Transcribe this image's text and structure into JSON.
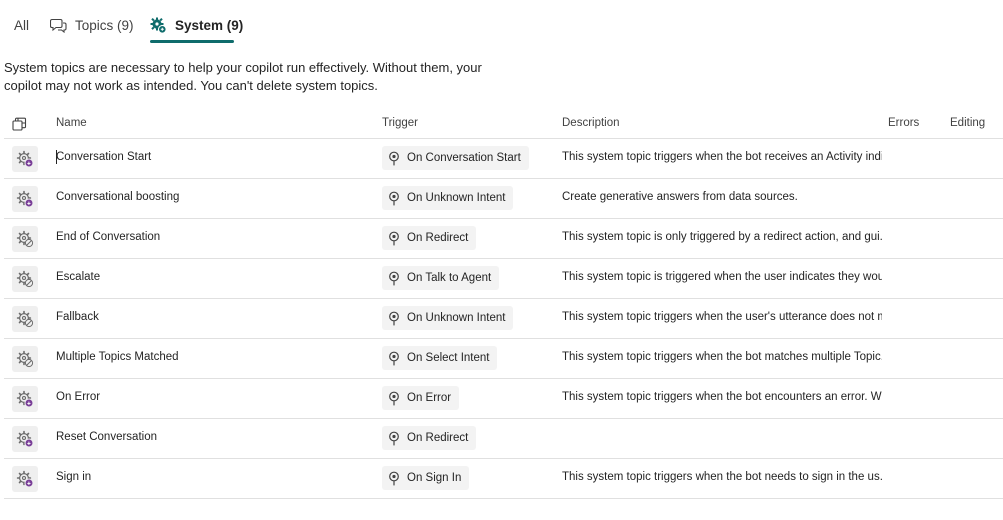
{
  "tabs": {
    "all": "All",
    "topics": "Topics (9)",
    "system": "System (9)"
  },
  "info_text": "System topics are necessary to help your copilot run effectively. Without them, your copilot may not work as intended. You can't delete system topics.",
  "columns": {
    "name": "Name",
    "trigger": "Trigger",
    "description": "Description",
    "errors": "Errors",
    "editing": "Editing"
  },
  "colors": {
    "accent": "#0f6c6c",
    "icon_purple": "#7a3f98",
    "icon_gray": "#6b6b6b"
  },
  "rows": [
    {
      "name": "Conversation Start",
      "trigger": "On Conversation Start",
      "description": "This system topic triggers when the bot receives an Activity indi...",
      "status_icon": "custom-topic-icon"
    },
    {
      "name": "Conversational boosting",
      "trigger": "On Unknown Intent",
      "description": "Create generative answers from data sources.",
      "status_icon": "custom-topic-icon"
    },
    {
      "name": "End of Conversation",
      "trigger": "On Redirect",
      "description": "This system topic is only triggered by a redirect action, and gui...",
      "status_icon": "disabled-topic-icon"
    },
    {
      "name": "Escalate",
      "trigger": "On Talk to Agent",
      "description": "This system topic is triggered when the user indicates they woul...",
      "status_icon": "disabled-topic-icon"
    },
    {
      "name": "Fallback",
      "trigger": "On Unknown Intent",
      "description": "This system topic triggers when the user's utterance does not m...",
      "status_icon": "disabled-topic-icon"
    },
    {
      "name": "Multiple Topics Matched",
      "trigger": "On Select Intent",
      "description": "This system topic triggers when the bot matches multiple Topic...",
      "status_icon": "disabled-topic-icon"
    },
    {
      "name": "On Error",
      "trigger": "On Error",
      "description": "This system topic triggers when the bot encounters an error. W...",
      "status_icon": "custom-topic-icon"
    },
    {
      "name": "Reset Conversation",
      "trigger": "On Redirect",
      "description": "",
      "status_icon": "custom-topic-icon"
    },
    {
      "name": "Sign in",
      "trigger": "On Sign In",
      "description": "This system topic triggers when the bot needs to sign in the us...",
      "status_icon": "custom-topic-icon"
    }
  ]
}
